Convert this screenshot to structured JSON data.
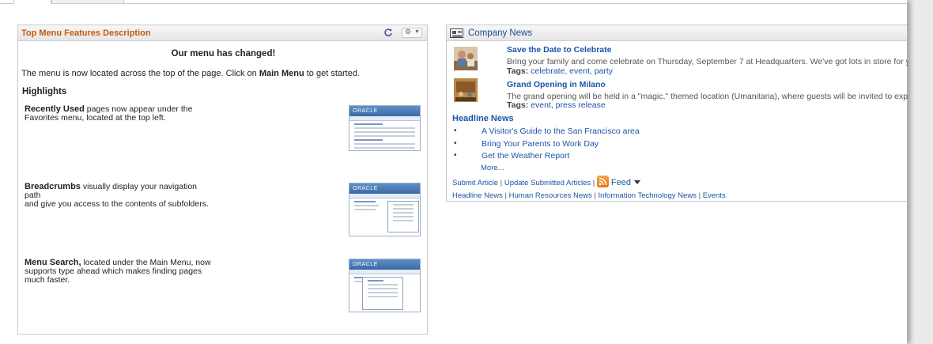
{
  "tabs": [
    {
      "label": ""
    },
    {
      "label": ""
    }
  ],
  "left_pagelet": {
    "title": "Top Menu Features Description",
    "heading": "Our menu has changed!",
    "intro_before": "The menu is now located across the top of the page. Click on ",
    "intro_bold": "Main Menu",
    "intro_after": " to get started.",
    "highlights_label": "Highlights",
    "features": [
      {
        "bold": "Recently Used",
        "text": " pages now appear under the",
        "line2": "Favorites menu, located at the top left."
      },
      {
        "bold": "Breadcrumbs",
        "text": " visually display your navigation path",
        "line2": "and give you access to the contents of subfolders."
      },
      {
        "bold": "Menu Search,",
        "text": " located under the Main Menu, now",
        "line2": "supports type ahead which makes finding pages",
        "line3": "much faster."
      }
    ],
    "screenshot_brand": "ORACLE"
  },
  "right_pagelet": {
    "title": "Company News",
    "items": [
      {
        "title": "Save the Date to Celebrate",
        "desc": "Bring your family and come celebrate on Thursday, September 7 at Headquarters. We've got lots in store for you",
        "tags_label": "Tags:",
        "tags": "celebrate, event, party"
      },
      {
        "title": "Grand Opening in Milano",
        "desc": "The grand opening will be held in a \"magic,\" themed location (Umanitaria), where guests will be invited to experi",
        "tags_label": "Tags:",
        "tags": "event, press release"
      }
    ],
    "headline_title": "Headline News",
    "headlines": [
      "A Visitor's Guide to the San Francisco area",
      "Bring Your Parents to Work Day",
      "Get the Weather Report"
    ],
    "bullet": "•",
    "more": "More...",
    "submit_article": "Submit Article",
    "update_articles": "Update Submitted Articles",
    "feed": "Feed",
    "footer_links": [
      "Headline News",
      "Human Resources News",
      "Information Technology News",
      "Events"
    ],
    "separator": "|"
  },
  "colors": {
    "left_title": "#c35a0c",
    "link": "#1a55a8"
  }
}
